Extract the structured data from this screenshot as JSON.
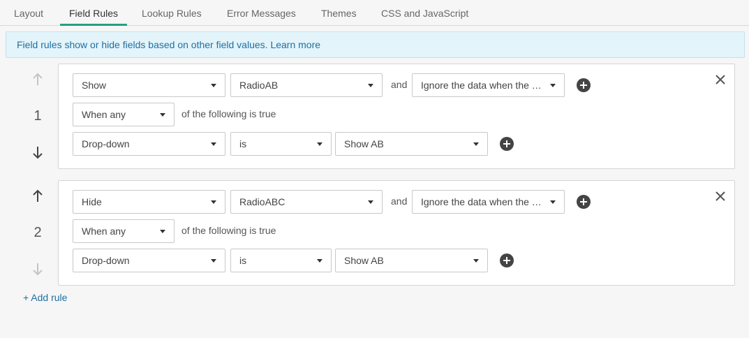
{
  "tabs": [
    {
      "label": "Layout"
    },
    {
      "label": "Field Rules"
    },
    {
      "label": "Lookup Rules"
    },
    {
      "label": "Error Messages"
    },
    {
      "label": "Themes"
    },
    {
      "label": "CSS and JavaScript"
    }
  ],
  "active_tab": "Field Rules",
  "banner": {
    "text": "Field rules show or hide fields based on other field values.",
    "link": "Learn more"
  },
  "rules": [
    {
      "number": "1",
      "action": "Show",
      "field": "RadioAB",
      "and_label": "and",
      "data_option": "Ignore the data when the …",
      "match": "When any",
      "match_suffix": "of the following is true",
      "condition": {
        "field": "Drop-down",
        "operator": "is",
        "value": "Show AB"
      }
    },
    {
      "number": "2",
      "action": "Hide",
      "field": "RadioABC",
      "and_label": "and",
      "data_option": "Ignore the data when the …",
      "match": "When any",
      "match_suffix": "of the following is true",
      "condition": {
        "field": "Drop-down",
        "operator": "is",
        "value": "Show AB"
      }
    }
  ],
  "add_rule": "+ Add rule",
  "colors": {
    "accent": "#24a086",
    "link": "#1e6fa3",
    "banner_bg": "#e3f4fa"
  },
  "icons": {
    "move_up": "arrow-up-icon",
    "move_down": "arrow-down-icon",
    "add": "plus-circle-icon",
    "remove": "close-icon"
  }
}
